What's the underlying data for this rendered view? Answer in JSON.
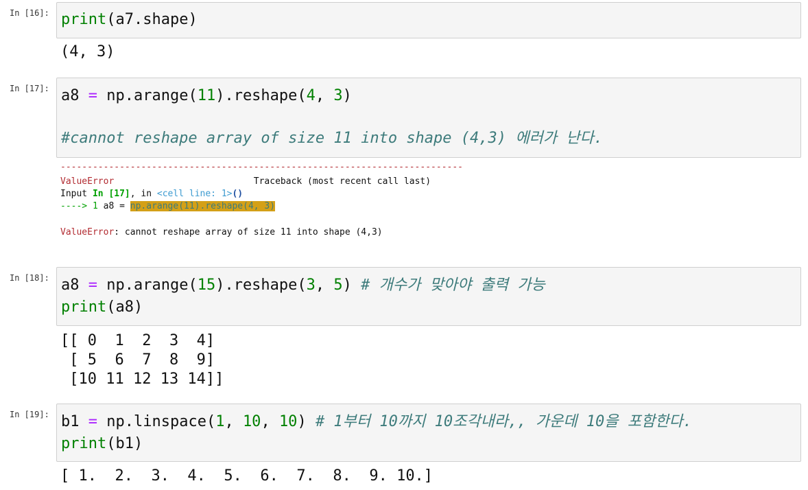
{
  "cells": [
    {
      "prompt": "In [16]:",
      "code": [
        [
          "print",
          "(a7.shape)"
        ]
      ],
      "output": "(4, 3)"
    },
    {
      "prompt": "In [17]:",
      "code_line1": {
        "a": "a8 ",
        "eq": "=",
        "b": " np.arange(",
        "n1": "11",
        "c": ").reshape(",
        "n2": "4",
        "d": ", ",
        "n3": "3",
        "e": ")"
      },
      "comment": "#cannot reshape array of size 11 into shape (4,3) 에러가 난다.",
      "traceback": {
        "dashes": "---------------------------------------------------------------------------",
        "error_name": "ValueError",
        "header_right": "Traceback (most recent call last)",
        "input_line_a": "Input ",
        "input_line_in": "In [17]",
        "input_line_b": ", in ",
        "input_line_cell": "<cell line: 1>",
        "input_line_c": "()",
        "arrow": "----> 1 ",
        "arrow_code_pre": "a8 = ",
        "arrow_code_hl": "np.arange(11).reshape(4, 3)",
        "final_error_name": "ValueError",
        "final_message": ": cannot reshape array of size 11 into shape (4,3)"
      }
    },
    {
      "prompt": "In [18]:",
      "code_line1": {
        "a": "a8 ",
        "eq": "=",
        "b": " np.arange(",
        "n1": "15",
        "c": ").reshape(",
        "n2": "3",
        "d": ", ",
        "n3": "5",
        "e": ") ",
        "cmt": "# 개수가 맞아야 출력 가능"
      },
      "code_line2": {
        "kw": "print",
        "rest": "(a8)"
      },
      "output": "[[ 0  1  2  3  4]\n [ 5  6  7  8  9]\n [10 11 12 13 14]]"
    },
    {
      "prompt": "In [19]:",
      "code_line1": {
        "a": "b1 ",
        "eq": "=",
        "b": " np.linspace(",
        "n1": "1",
        "d1": ", ",
        "n2": "10",
        "d2": ", ",
        "n3": "10",
        "e": ") ",
        "cmt": "# 1부터 10까지 10조각내라,, 가운데 10을 포함한다."
      },
      "code_line2": {
        "kw": "print",
        "rest": "(b1)"
      },
      "output": "[ 1.  2.  3.  4.  5.  6.  7.  8.  9. 10.]"
    }
  ]
}
